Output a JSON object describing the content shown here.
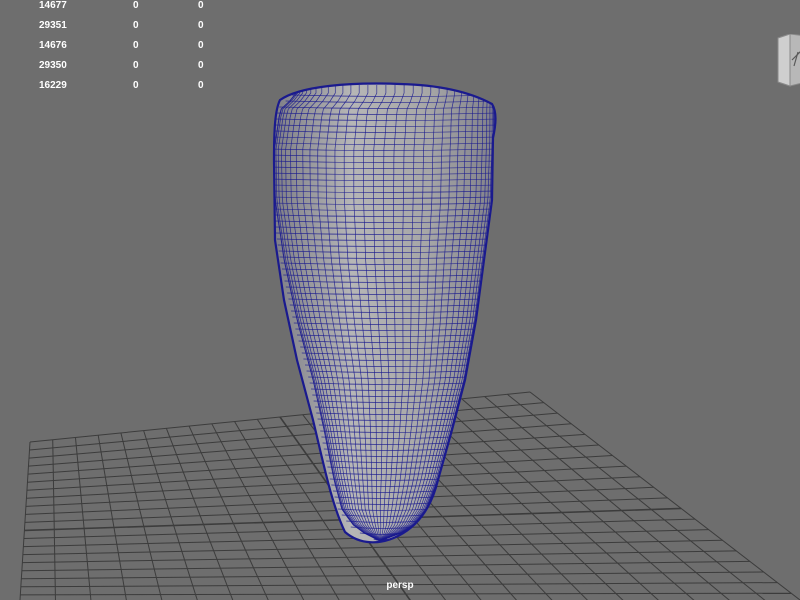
{
  "hud": {
    "rows": [
      [
        "14677",
        "0",
        "0"
      ],
      [
        "29351",
        "0",
        "0"
      ],
      [
        "14676",
        "0",
        "0"
      ],
      [
        "29350",
        "0",
        "0"
      ],
      [
        "16229",
        "0",
        "0"
      ]
    ]
  },
  "viewport": {
    "camera_label": "persp"
  },
  "view_cube": {
    "icon": "view-cube-icon"
  },
  "colors": {
    "background": "#6e6e6e",
    "grid_line": "#3c3c3c",
    "mesh_fill": "#a4a4a4",
    "wireframe": "#1a1a8e",
    "hud_text": "#ffffff"
  }
}
